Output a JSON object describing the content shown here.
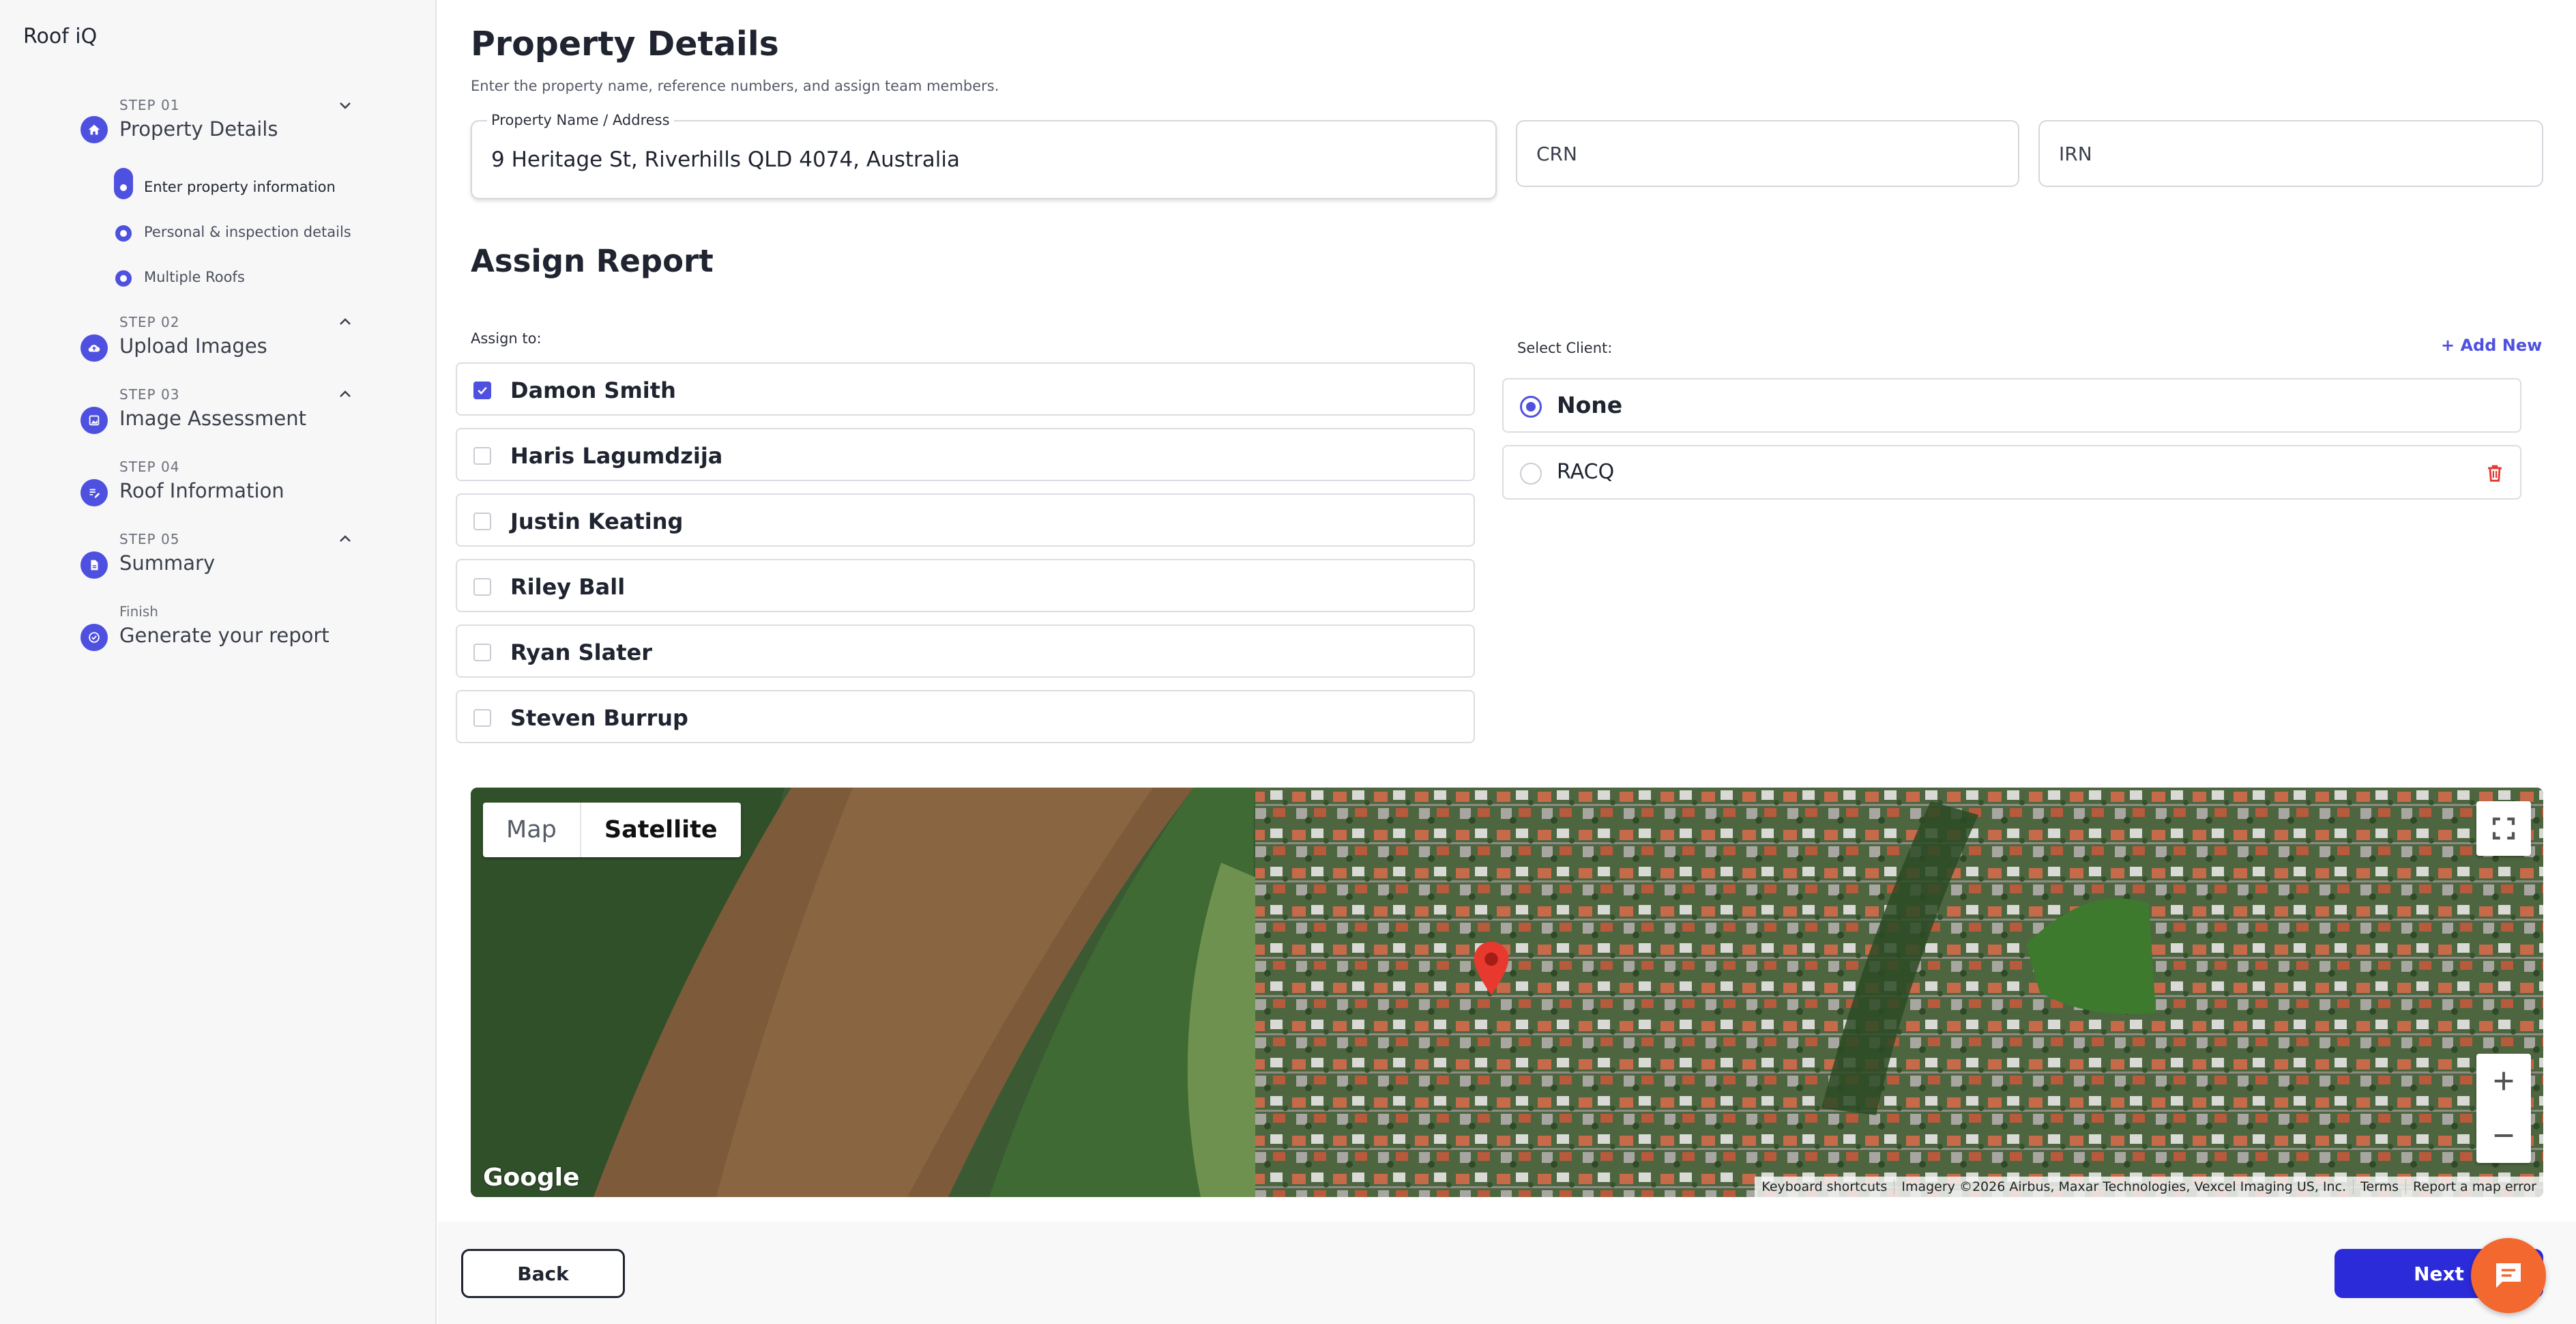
{
  "app": {
    "brand": "Roof iQ"
  },
  "colors": {
    "accent": "#4e50e0",
    "primary_button": "#2b2bd9",
    "chat": "#f2682f",
    "danger": "#e53935"
  },
  "sidebar": {
    "steps": [
      {
        "label": "STEP 01",
        "title": "Property Details",
        "icon": "home-icon",
        "chevron": "chevron-down-icon"
      },
      {
        "label": "STEP 02",
        "title": "Upload Images",
        "icon": "cloud-upload-icon",
        "chevron": "chevron-up-icon"
      },
      {
        "label": "STEP 03",
        "title": "Image Assessment",
        "icon": "image-icon",
        "chevron": "chevron-up-icon"
      },
      {
        "label": "STEP 04",
        "title": "Roof Information",
        "icon": "edit-list-icon",
        "chevron": ""
      },
      {
        "label": "STEP 05",
        "title": "Summary",
        "icon": "document-icon",
        "chevron": "chevron-up-icon"
      },
      {
        "label": "Finish",
        "title": "Generate your report",
        "icon": "check-circle-icon",
        "chevron": ""
      }
    ],
    "substeps": [
      {
        "label": "Enter property information",
        "active": true
      },
      {
        "label": "Personal & inspection details",
        "active": false
      },
      {
        "label": "Multiple Roofs",
        "active": false
      }
    ]
  },
  "main": {
    "title": "Property Details",
    "subtitle": "Enter the property name, reference numbers, and assign team members.",
    "fields": {
      "property": {
        "label": "Property Name / Address",
        "value": "9 Heritage St, Riverhills QLD 4074, Australia"
      },
      "crn": {
        "placeholder": "CRN"
      },
      "irn": {
        "placeholder": "IRN"
      }
    },
    "assign": {
      "title": "Assign Report",
      "assign_label": "Assign to:",
      "assignees": [
        {
          "name": "Damon Smith",
          "checked": true
        },
        {
          "name": "Haris Lagumdzija",
          "checked": false
        },
        {
          "name": "Justin Keating",
          "checked": false
        },
        {
          "name": "Riley Ball",
          "checked": false
        },
        {
          "name": "Ryan Slater",
          "checked": false
        },
        {
          "name": "Steven Burrup",
          "checked": false
        }
      ],
      "client_label": "Select Client:",
      "add_new": "+ Add New",
      "clients": [
        {
          "name": "None",
          "selected": true
        },
        {
          "name": "RACQ",
          "selected": false
        }
      ]
    },
    "map": {
      "toggle_map": "Map",
      "toggle_satellite": "Satellite",
      "selected_view": "Satellite",
      "google": "Google",
      "attribution": [
        "Keyboard shortcuts",
        "Imagery ©2026 Airbus, Maxar Technologies, Vexcel Imaging US, Inc.",
        "Terms",
        "Report a map error"
      ]
    }
  },
  "footer": {
    "back": "Back",
    "next": "Next"
  }
}
